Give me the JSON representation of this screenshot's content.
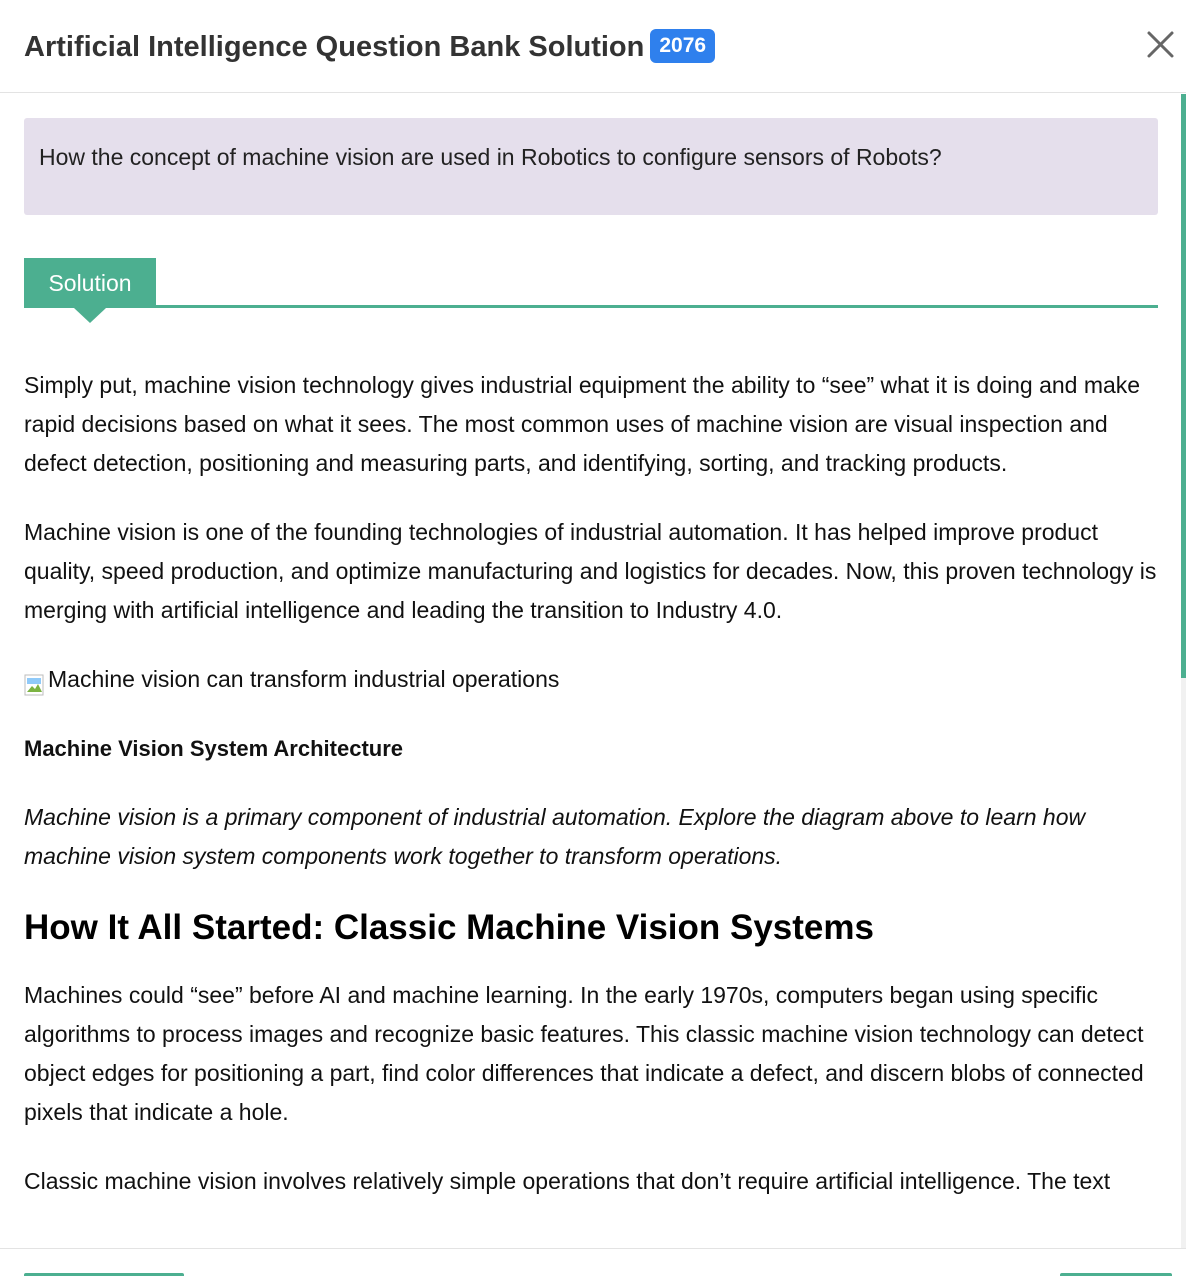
{
  "header": {
    "title": "Artificial Intelligence Question Bank Solution",
    "year_badge": "2076",
    "close_icon": "close-icon"
  },
  "question": {
    "text": "How the concept of machine vision are used in Robotics to configure sensors of Robots?"
  },
  "solution_tab": {
    "label": "Solution"
  },
  "content": {
    "p1": "Simply put, machine vision technology gives industrial equipment the ability to “see” what it is doing and make rapid decisions based on what it sees. The most common uses of machine vision are visual inspection and defect detection, positioning and measuring parts, and identifying, sorting, and tracking products.",
    "p2": "Machine vision is one of the founding technologies of industrial automation. It has helped improve product quality, speed production, and optimize manufacturing and logistics for decades. Now, this proven technology is merging with artificial intelligence and leading the transition to Industry 4.0.",
    "image_alt": "Machine vision can transform industrial operations",
    "section_title": "Machine Vision System Architecture",
    "italic_note": "Machine vision is a primary component of industrial automation. Explore the diagram above to learn how machine vision system components work together to transform operations.",
    "heading": "How It All Started: Classic Machine Vision Systems",
    "p3": "Machines could “see” before AI and machine learning. In the early 1970s, computers began using specific algorithms to process images and recognize basic features. This classic machine vision technology can detect object edges for positioning a part, find color differences that indicate a defect, and discern blobs of connected pixels that indicate a hole.",
    "p4": "Classic machine vision involves relatively simple operations that don’t require artificial intelligence. The text"
  },
  "colors": {
    "accent": "#4caf90",
    "badge": "#2f80ed",
    "question_bg": "#e5dfec"
  }
}
